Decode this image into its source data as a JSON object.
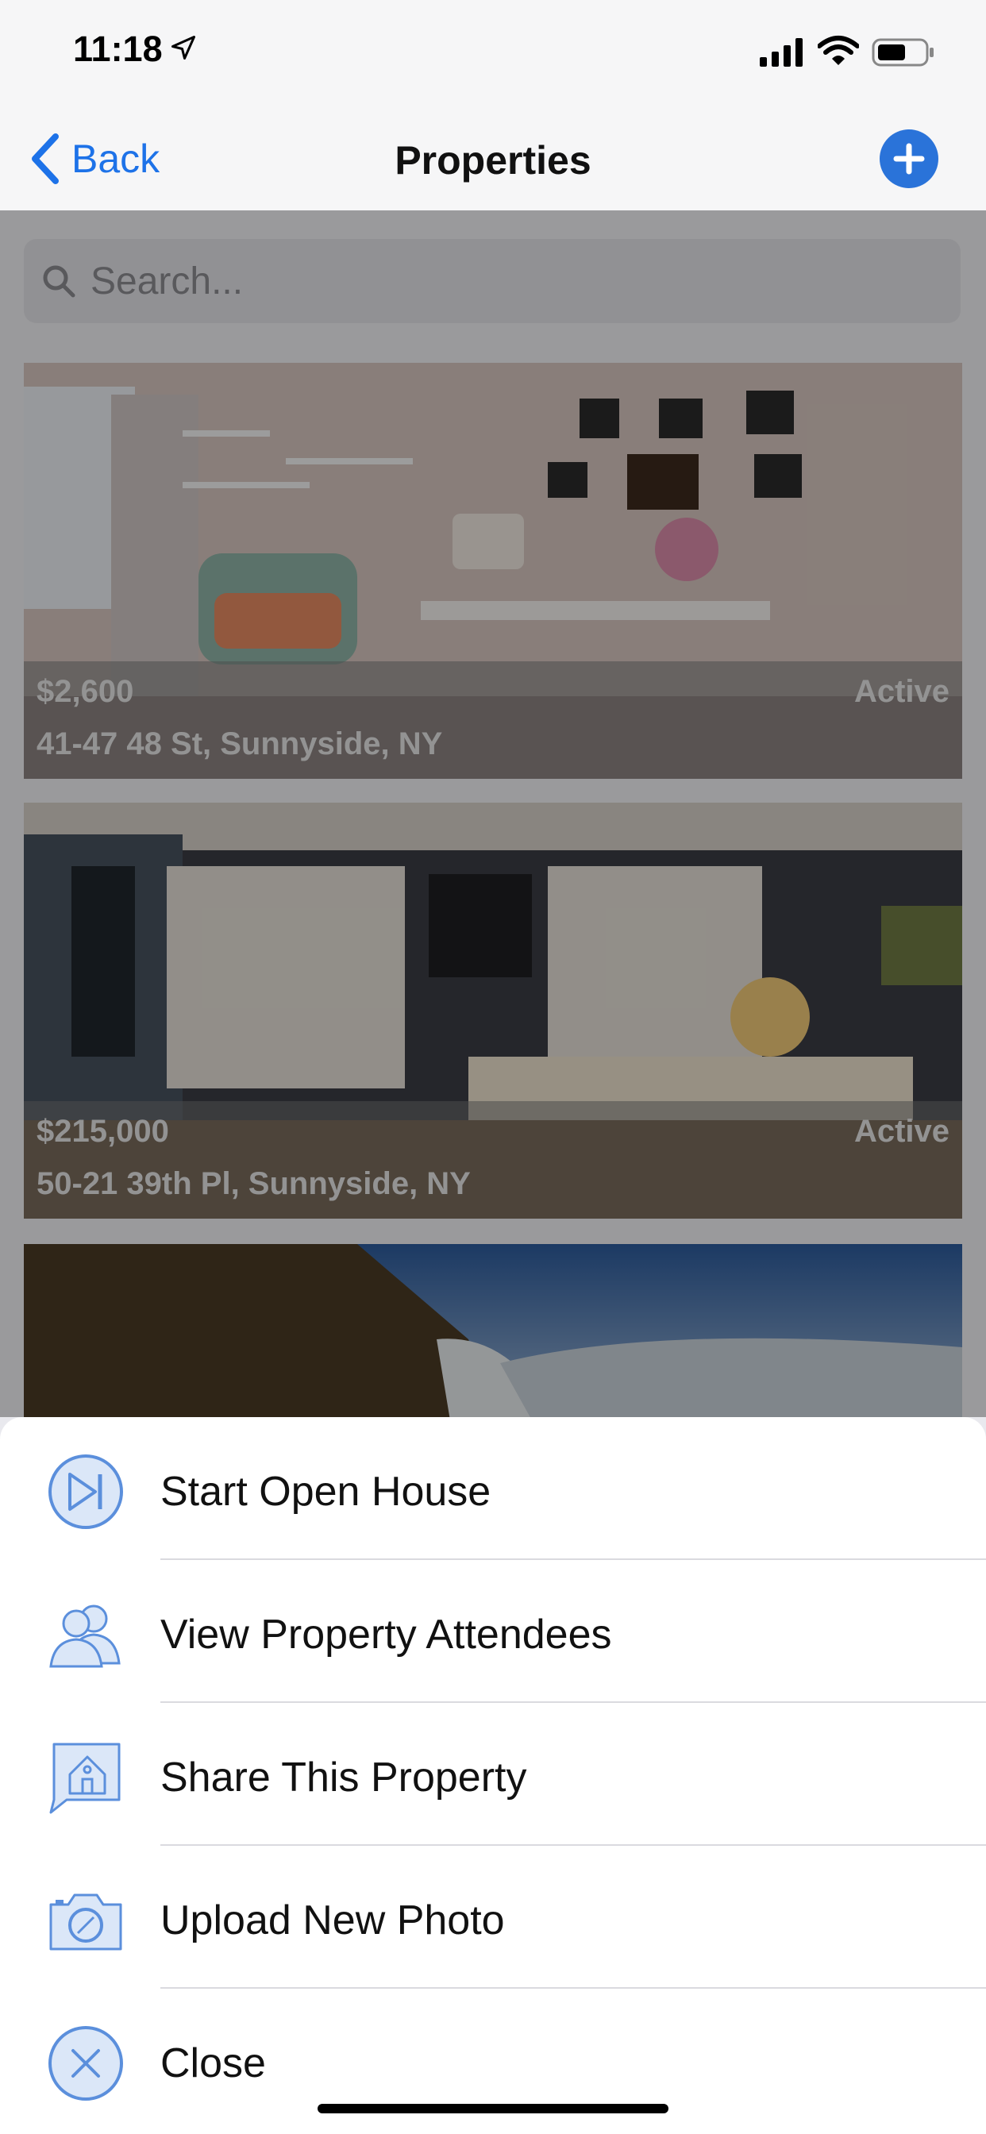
{
  "status_bar": {
    "time": "11:18"
  },
  "nav": {
    "back_label": "Back",
    "title": "Properties"
  },
  "search": {
    "placeholder": "Search..."
  },
  "listings": [
    {
      "price": "$2,600",
      "status": "Active",
      "address": "41-47 48 St, Sunnyside, NY"
    },
    {
      "price": "$215,000",
      "status": "Active",
      "address": "50-21 39th Pl, Sunnyside, NY"
    }
  ],
  "action_sheet": {
    "items": [
      {
        "label": "Start Open House",
        "icon": "play-next-icon"
      },
      {
        "label": "View Property Attendees",
        "icon": "people-icon"
      },
      {
        "label": "Share This Property",
        "icon": "share-house-icon"
      },
      {
        "label": "Upload New Photo",
        "icon": "camera-icon"
      },
      {
        "label": "Close",
        "icon": "close-icon"
      }
    ]
  },
  "colors": {
    "accent": "#1d72e8",
    "icon_stroke": "#5b8fdc",
    "icon_fill": "#dbe7f8"
  }
}
